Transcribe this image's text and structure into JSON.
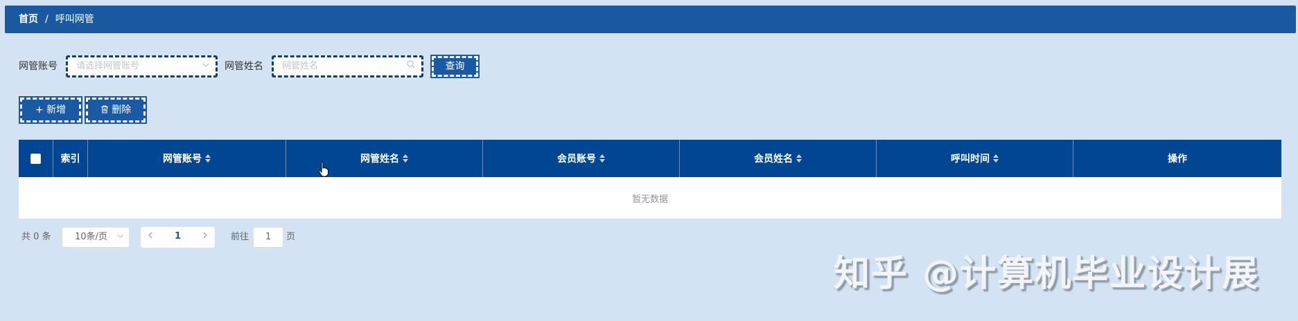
{
  "breadcrumb": {
    "home": "首页",
    "separator": "/",
    "current": "呼叫网管"
  },
  "search": {
    "account_label": "网管账号",
    "account_placeholder": "请选择网管账号",
    "name_label": "网管姓名",
    "name_placeholder": "网管姓名",
    "query_button": "查询"
  },
  "toolbar": {
    "add_label": "新增",
    "add_icon": "+",
    "delete_label": "删除",
    "delete_icon": "trash-icon"
  },
  "table": {
    "columns": [
      "索引",
      "网管账号",
      "网管姓名",
      "会员账号",
      "会员姓名",
      "呼叫时间",
      "操作"
    ],
    "empty_text": "暂无数据"
  },
  "pagination": {
    "total_text": "共 0 条",
    "page_size": "10条/页",
    "current_page": "1",
    "goto_label": "前往",
    "goto_value": "1",
    "page_suffix": "页"
  },
  "watermark": "知乎 @计算机毕业设计展",
  "colors": {
    "header_bar": "#1a58a0",
    "table_header": "#004692",
    "background": "#d3e3f3"
  }
}
